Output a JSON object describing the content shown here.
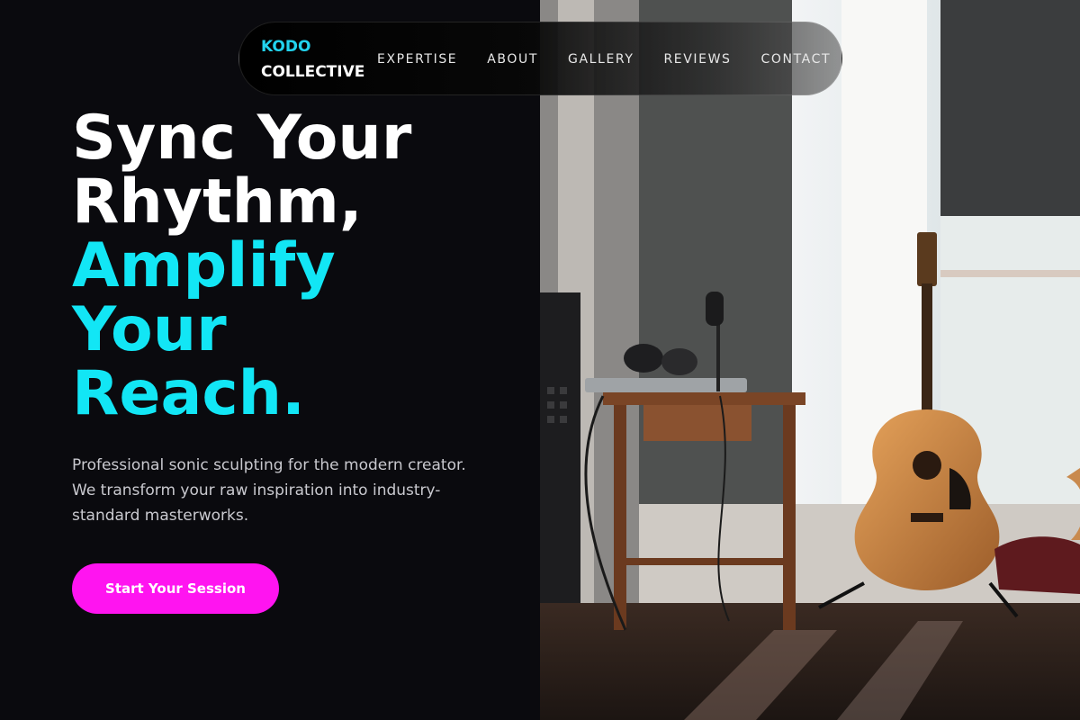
{
  "brand": {
    "line1": "KODO",
    "line2": "COLLECTIVE",
    "accent": "#22d3ee"
  },
  "nav": {
    "items": [
      "EXPERTISE",
      "ABOUT",
      "GALLERY",
      "REVIEWS",
      "CONTACT"
    ]
  },
  "hero": {
    "headline_white": [
      "Sync Your",
      "Rhythm,"
    ],
    "headline_cyan": [
      "Amplify",
      "Your",
      "Reach."
    ],
    "subtext": "Professional sonic sculpting for the modern creator. We transform your raw inspiration into industry-standard masterworks.",
    "cta_label": "Start Your Session"
  },
  "colors": {
    "background": "#0a0a0e",
    "headline_accent": "#12e6f5",
    "cta": "#ff14f0"
  },
  "photo": {
    "subject": "studio-room-with-guitar-headphones-and-microphone"
  }
}
